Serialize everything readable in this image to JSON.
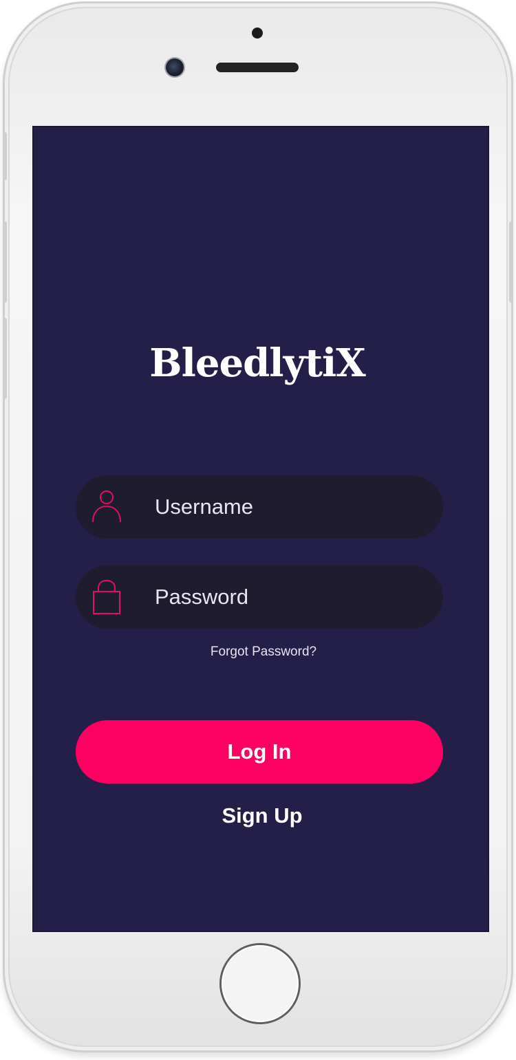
{
  "app": {
    "title": "BleedlytiX"
  },
  "login_form": {
    "username": {
      "placeholder": "Username",
      "icon": "user-icon"
    },
    "password": {
      "placeholder": "Password",
      "icon": "lock-icon"
    },
    "forgot_password_label": "Forgot Password?",
    "login_label": "Log In",
    "signup_label": "Sign Up"
  },
  "colors": {
    "screen_background": "#241f48",
    "field_background": "#1f1c2f",
    "accent": "#ff0062",
    "icon_stroke": "#e0115f",
    "text": "#ffffff"
  }
}
